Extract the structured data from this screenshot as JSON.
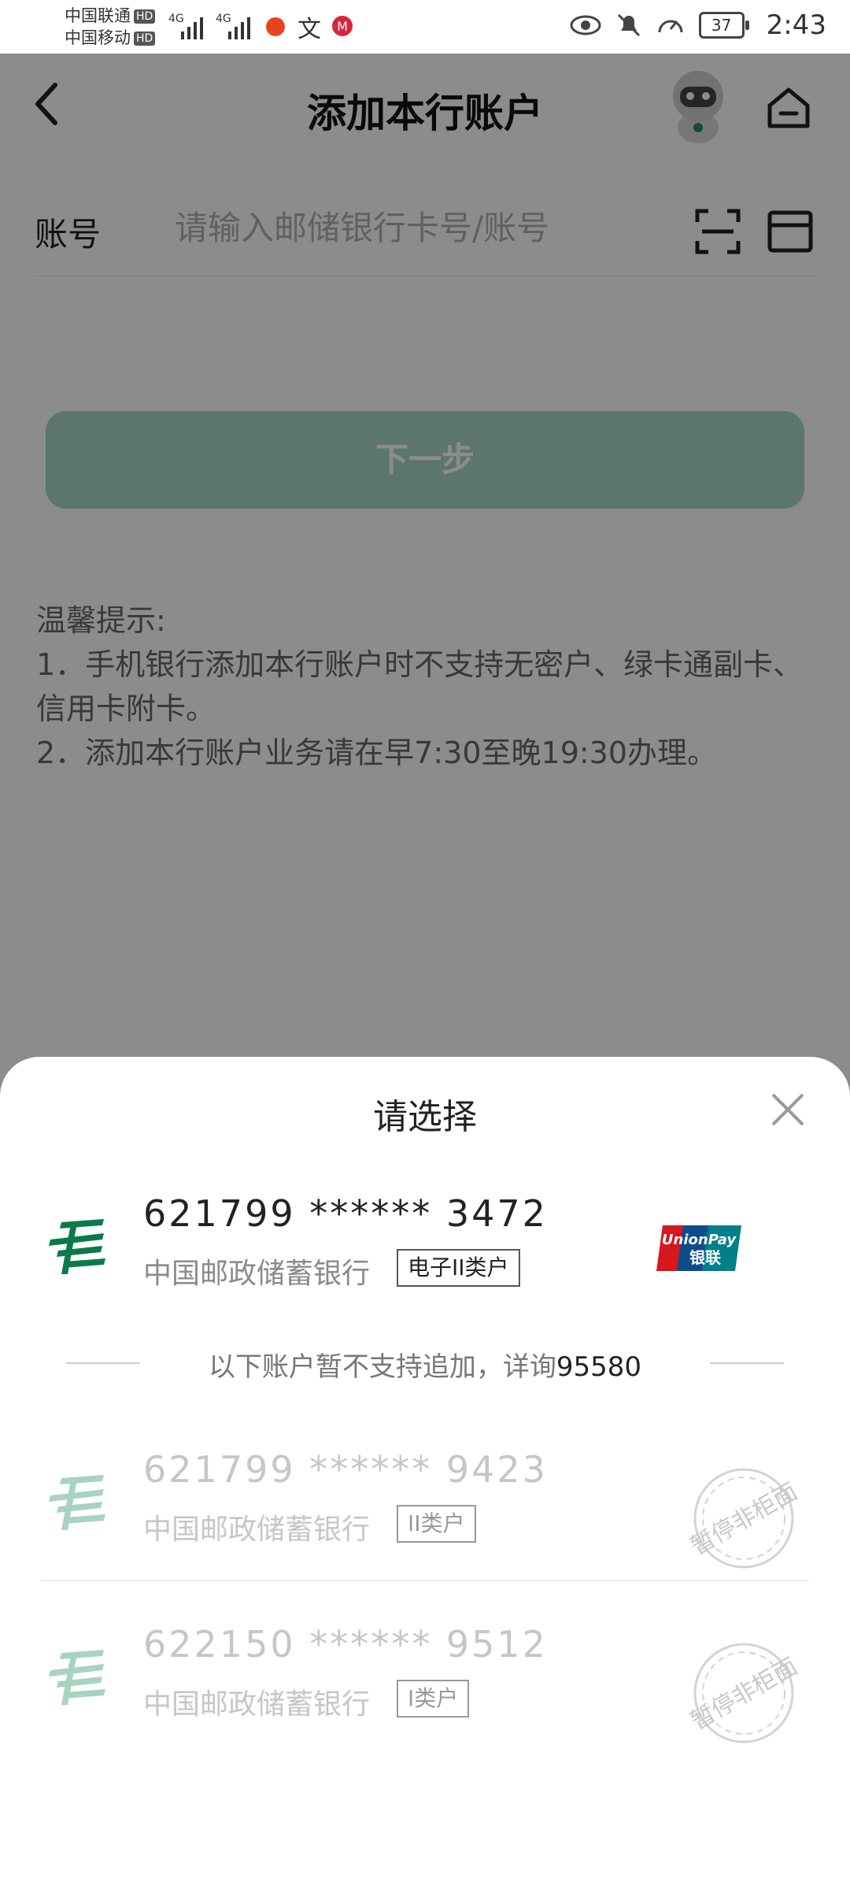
{
  "status_bar": {
    "carrier1": "中国联通",
    "carrier2": "中国移动",
    "hd": "HD",
    "network1": "4G",
    "network2": "4G",
    "battery": "37",
    "time": "2:43"
  },
  "header": {
    "title": "添加本行账户"
  },
  "account_field": {
    "label": "账号",
    "placeholder": "请输入邮储银行卡号/账号"
  },
  "next_button": {
    "label": "下一步"
  },
  "tips": {
    "heading": "温馨提示:",
    "line1": "1．手机银行添加本行账户时不支持无密户、绿卡通副卡、信用卡附卡。",
    "line2": "2．添加本行账户业务请在早7:30至晚19:30办理。"
  },
  "sheet": {
    "title": "请选择",
    "note_prefix": "以下账户暂不支持追加，详询",
    "note_number": "95580",
    "cards": [
      {
        "number": "621799 ****** 3472",
        "bank": "中国邮政储蓄银行",
        "tag": "电子II类户",
        "enabled": true
      },
      {
        "number": "621799 ****** 9423",
        "bank": "中国邮政储蓄银行",
        "tag": "II类户",
        "enabled": false,
        "stamp": "暂停非柜面"
      },
      {
        "number": "622150 ****** 9512",
        "bank": "中国邮政储蓄银行",
        "tag": "I类户",
        "enabled": false,
        "stamp": "暂停非柜面"
      }
    ]
  },
  "colors": {
    "brand_green": "#0b7a4b",
    "button_disabled": "#a8d7c3",
    "unionpay_red": "#d7171e",
    "unionpay_blue": "#0d4d8c",
    "unionpay_teal": "#00808a"
  }
}
